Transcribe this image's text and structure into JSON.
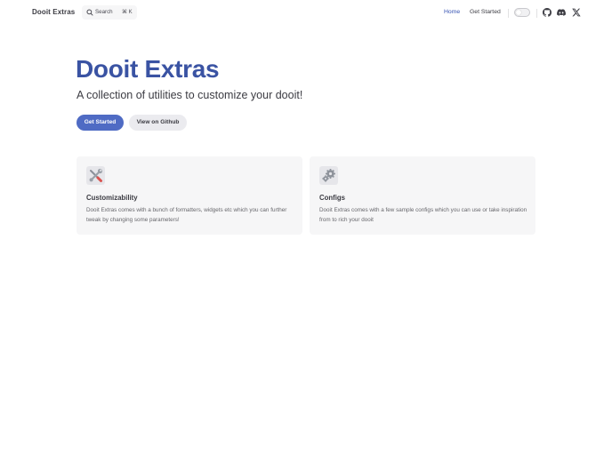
{
  "nav": {
    "brand": "Dooit Extras",
    "search_label": "Search",
    "search_shortcut": "⌘ K",
    "links": [
      {
        "label": "Home",
        "active": true
      },
      {
        "label": "Get Started",
        "active": false
      }
    ],
    "social_icons": [
      "github-icon",
      "discord-icon",
      "x-icon"
    ]
  },
  "hero": {
    "title": "Dooit Extras",
    "tagline": "A collection of utilities to customize your dooit!",
    "primary_button": "Get Started",
    "secondary_button": "View on Github"
  },
  "features": [
    {
      "icon": "tools-icon",
      "title": "Customizability",
      "description": "Dooit Extras comes with a bunch of formatters, widgets etc which you can further tweak by changing some parameters!"
    },
    {
      "icon": "gears-icon",
      "title": "Configs",
      "description": "Dooit Extras comes with a few sample configs which you can use or take inspiration from to rich your dooit"
    }
  ],
  "colors": {
    "brand": "#3a53a3",
    "primary_button": "#4f6bc4",
    "active_link": "#3451b2",
    "card_bg": "#f6f6f7"
  }
}
